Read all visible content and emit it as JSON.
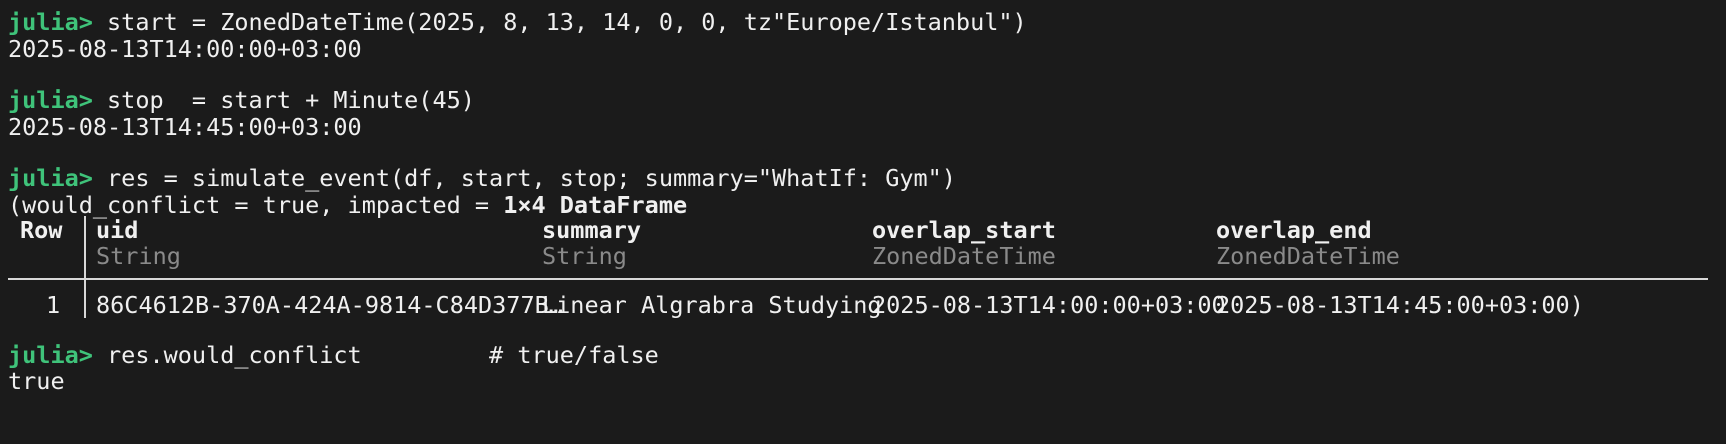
{
  "terminal": {
    "prompt": "julia>",
    "commands": [
      {
        "input": " start = ZonedDateTime(2025, 8, 13, 14, 0, 0, tz\"Europe/Istanbul\")",
        "output": "2025-08-13T14:00:00+03:00"
      },
      {
        "input": " stop  = start + Minute(45)",
        "output": "2025-08-13T14:45:00+03:00"
      },
      {
        "input": " res = simulate_event(df, start, stop; summary=\"WhatIf: Gym\")"
      },
      {
        "input": " res.would_conflict         # true/false",
        "output": "true"
      }
    ],
    "result_prefix": "(would_conflict = true, impacted = ",
    "result_dataframe_label": "1×4 DataFrame",
    "table": {
      "row_header": "Row",
      "columns": [
        {
          "name": "uid",
          "type": "String"
        },
        {
          "name": "summary",
          "type": "String"
        },
        {
          "name": "overlap_start",
          "type": "ZonedDateTime"
        },
        {
          "name": "overlap_end",
          "type": "ZonedDateTime"
        }
      ],
      "rows": [
        {
          "row": "1",
          "cells": [
            "86C4612B-370A-424A-9814-C84D377B…",
            "Linear Algrabra Studying",
            "2025-08-13T14:00:00+03:00",
            "2025-08-13T14:45:00+03:00)"
          ]
        }
      ]
    }
  },
  "colors": {
    "background": "#1b1b1b",
    "prompt": "#3fc37a",
    "text": "#f0f0f0",
    "muted_type": "#8a8a8a"
  }
}
